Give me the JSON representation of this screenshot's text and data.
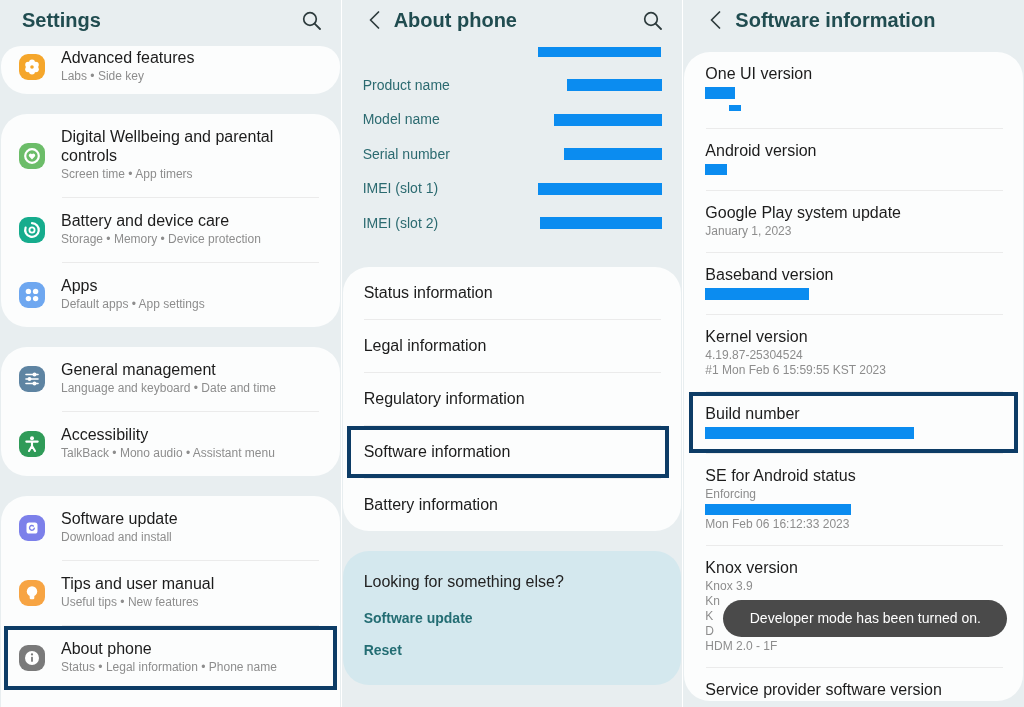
{
  "settings_screen": {
    "title": "Settings",
    "back_button": false,
    "search_button": true,
    "groups": [
      {
        "items": [
          {
            "title": "Advanced features",
            "subtitle": "Labs • Side key",
            "color": "#f5a62b",
            "highlighted": false
          }
        ]
      },
      {
        "items": [
          {
            "title": "Digital Wellbeing and parental controls",
            "subtitle": "Screen time • App timers",
            "color": "#6cbd69",
            "highlighted": false
          },
          {
            "title": "Battery and device care",
            "subtitle": "Storage • Memory • Device protection",
            "color": "#16ac8d",
            "highlighted": false
          },
          {
            "title": "Apps",
            "subtitle": "Default apps • App settings",
            "color": "#6ea7f0",
            "highlighted": false
          }
        ]
      },
      {
        "items": [
          {
            "title": "General management",
            "subtitle": "Language and keyboard • Date and time",
            "color": "#5e84a2",
            "highlighted": false
          },
          {
            "title": "Accessibility",
            "subtitle": "TalkBack • Mono audio • Assistant menu",
            "color": "#2f9b58",
            "highlighted": false
          }
        ]
      },
      {
        "items": [
          {
            "title": "Software update",
            "subtitle": "Download and install",
            "color": "#7c80ea",
            "highlighted": false
          },
          {
            "title": "Tips and user manual",
            "subtitle": "Useful tips • New features",
            "color": "#f7a443",
            "highlighted": false
          },
          {
            "title": "About phone",
            "subtitle": "Status • Legal information • Phone name",
            "color": "#7a7a7a",
            "highlighted": true
          }
        ]
      }
    ]
  },
  "about_phone_screen": {
    "title": "About phone",
    "back_button": true,
    "search_button": true,
    "name_redacted": true,
    "info_rows": [
      {
        "label": "Product name",
        "redacted": true
      },
      {
        "label": "Model name",
        "redacted": true
      },
      {
        "label": "Serial number",
        "redacted": true
      },
      {
        "label": "IMEI (slot 1)",
        "redacted": true
      },
      {
        "label": "IMEI (slot 2)",
        "redacted": true
      }
    ],
    "menu": [
      {
        "label": "Status information",
        "highlighted": false
      },
      {
        "label": "Legal information",
        "highlighted": false
      },
      {
        "label": "Regulatory information",
        "highlighted": false
      },
      {
        "label": "Software information",
        "highlighted": true
      },
      {
        "label": "Battery information",
        "highlighted": false
      }
    ],
    "suggestions": {
      "heading": "Looking for something else?",
      "links": [
        "Software update",
        "Reset"
      ]
    }
  },
  "software_info_screen": {
    "title": "Software information",
    "back_button": true,
    "search_button": false,
    "items": [
      {
        "title": "One UI version",
        "highlighted": false,
        "lines": [
          {
            "kind": "redacted"
          },
          {
            "kind": "redacted"
          }
        ]
      },
      {
        "title": "Android version",
        "highlighted": false,
        "lines": [
          {
            "kind": "redacted"
          }
        ]
      },
      {
        "title": "Google Play system update",
        "highlighted": false,
        "lines": [
          {
            "kind": "text",
            "text": "January 1, 2023"
          }
        ]
      },
      {
        "title": "Baseband version",
        "highlighted": false,
        "lines": [
          {
            "kind": "redacted"
          }
        ]
      },
      {
        "title": "Kernel version",
        "highlighted": false,
        "lines": [
          {
            "kind": "text",
            "text": "4.19.87-25304524"
          },
          {
            "kind": "text",
            "text": "#1 Mon Feb 6 15:59:55 KST 2023"
          }
        ]
      },
      {
        "title": "Build number",
        "highlighted": true,
        "lines": [
          {
            "kind": "redacted"
          }
        ]
      },
      {
        "title": "SE for Android status",
        "highlighted": false,
        "lines": [
          {
            "kind": "text",
            "text": "Enforcing"
          },
          {
            "kind": "redacted"
          },
          {
            "kind": "text",
            "text": "Mon Feb 06 16:12:33 2023"
          }
        ]
      },
      {
        "title": "Knox version",
        "highlighted": false,
        "lines": [
          {
            "kind": "text",
            "text": "Knox 3.9"
          },
          {
            "kind": "text",
            "text": "Kn"
          },
          {
            "kind": "text",
            "text": "K"
          },
          {
            "kind": "text",
            "text": "D"
          },
          {
            "kind": "text",
            "text": "HDM 2.0 - 1F"
          }
        ]
      },
      {
        "title": "Service provider software version",
        "highlighted": false
      }
    ],
    "toast": "Developer mode has been turned on."
  }
}
